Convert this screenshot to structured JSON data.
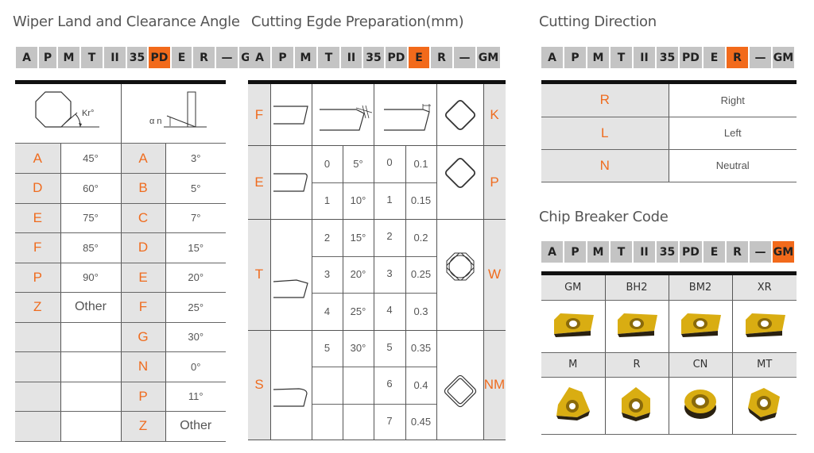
{
  "code_segments": [
    "A",
    "P",
    "M",
    "T",
    "II",
    "35",
    "PD",
    "E",
    "R",
    "—",
    "GM"
  ],
  "colors": {
    "highlight": "#f26a1b",
    "code_letter": "#ef6c1f",
    "segment_bg": "#c4c4c4",
    "gray_cell": "#e4e4e4"
  },
  "wiper": {
    "title": "Wiper Land and Clearance Angle",
    "highlight_segment": "PD",
    "header_left_label": "Kr°",
    "header_right_label": "α n",
    "rows": [
      {
        "code1": "A",
        "angle1": "45°",
        "code2": "A",
        "angle2": "3°"
      },
      {
        "code1": "D",
        "angle1": "60°",
        "code2": "B",
        "angle2": "5°"
      },
      {
        "code1": "E",
        "angle1": "75°",
        "code2": "C",
        "angle2": "7°"
      },
      {
        "code1": "F",
        "angle1": "85°",
        "code2": "D",
        "angle2": "15°"
      },
      {
        "code1": "P",
        "angle1": "90°",
        "code2": "E",
        "angle2": "20°"
      },
      {
        "code1": "Z",
        "angle1": "Other",
        "code2": "F",
        "angle2": "25°"
      },
      {
        "code1": "",
        "angle1": "",
        "code2": "G",
        "angle2": "30°"
      },
      {
        "code1": "",
        "angle1": "",
        "code2": "N",
        "angle2": "0°"
      },
      {
        "code1": "",
        "angle1": "",
        "code2": "P",
        "angle2": "11°"
      },
      {
        "code1": "",
        "angle1": "",
        "code2": "Z",
        "angle2": "Other"
      }
    ]
  },
  "edge": {
    "title": "Cutting Egde Preparation(mm)",
    "highlight_segment": "E",
    "left_codes": [
      "F",
      "E",
      "T",
      "S"
    ],
    "right_codes": [
      "K",
      "P",
      "W",
      "NM"
    ],
    "angle_rows": [
      {
        "n": "0",
        "angle": "5°"
      },
      {
        "n": "1",
        "angle": "10°"
      },
      {
        "n": "2",
        "angle": "15°"
      },
      {
        "n": "3",
        "angle": "20°"
      },
      {
        "n": "4",
        "angle": "25°"
      },
      {
        "n": "5",
        "angle": "30°"
      },
      {
        "n": "",
        "angle": ""
      },
      {
        "n": "",
        "angle": ""
      }
    ],
    "width_rows": [
      {
        "n": "0",
        "width": "0.1"
      },
      {
        "n": "1",
        "width": "0.15"
      },
      {
        "n": "2",
        "width": "0.2"
      },
      {
        "n": "3",
        "width": "0.25"
      },
      {
        "n": "4",
        "width": "0.3"
      },
      {
        "n": "5",
        "width": "0.35"
      },
      {
        "n": "6",
        "width": "0.4"
      },
      {
        "n": "7",
        "width": "0.45"
      }
    ]
  },
  "direction": {
    "title": "Cutting Direction",
    "highlight_segment": "R",
    "rows": [
      {
        "code": "R",
        "label": "Right"
      },
      {
        "code": "L",
        "label": "Left"
      },
      {
        "code": "N",
        "label": "Neutral"
      }
    ]
  },
  "chipbreaker": {
    "title": "Chip Breaker Code",
    "highlight_segment": "GM",
    "row1": [
      "GM",
      "BH2",
      "BM2",
      "XR"
    ],
    "row2": [
      "M",
      "R",
      "CN",
      "MT"
    ],
    "insert_icons_row1": [
      "rhombic-insert-icon",
      "rhombic-insert-icon",
      "rhombic-insert-icon",
      "rhombic-insert-icon"
    ],
    "insert_icons_row2": [
      "trigon-insert-icon",
      "pentagon-insert-icon",
      "round-insert-icon",
      "square-insert-icon"
    ]
  }
}
